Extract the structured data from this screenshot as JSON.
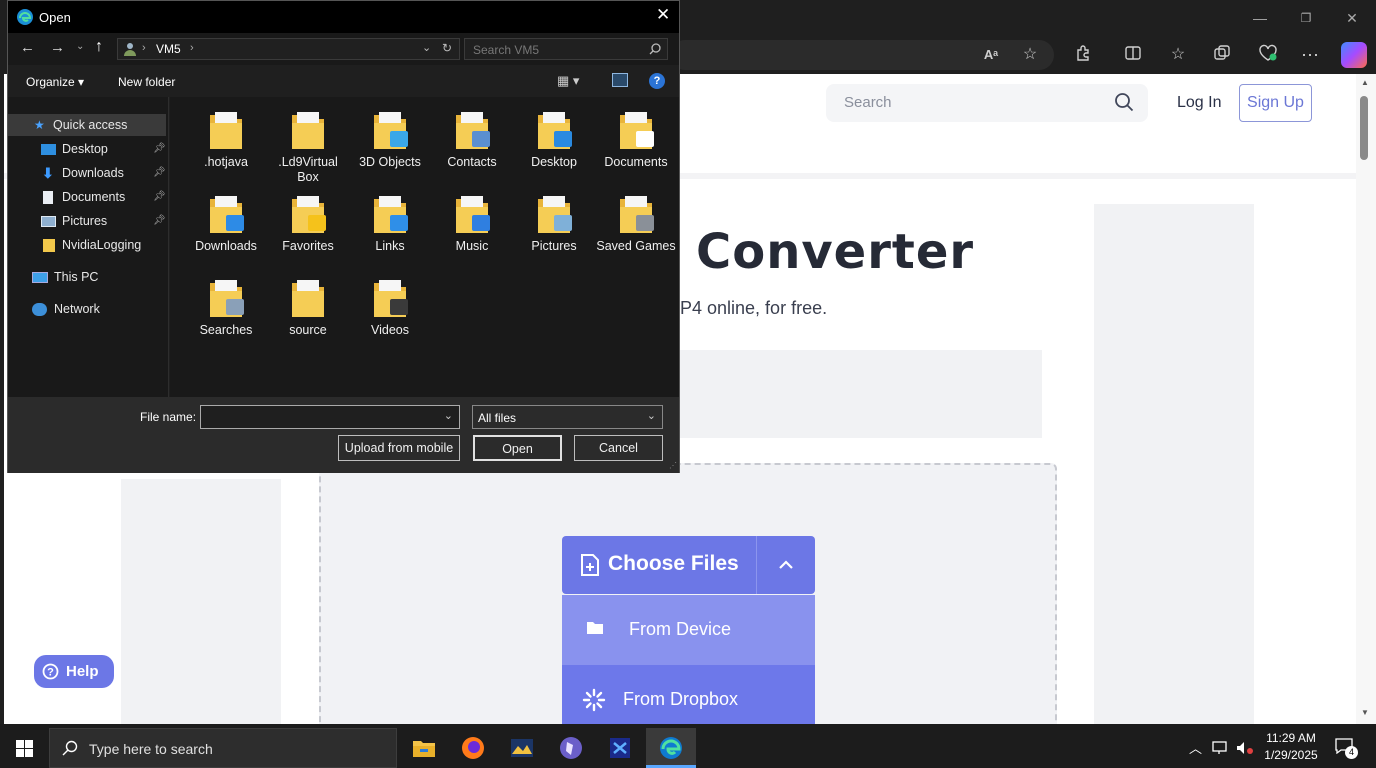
{
  "browser": {
    "window_controls": {
      "minimize": "—",
      "restore": "❐",
      "close": "✕"
    },
    "toolbar_icons": [
      "read-aloud-icon",
      "favorite-star-icon",
      "extensions-icon",
      "split-screen-icon",
      "favorites-icon",
      "collections-icon",
      "browser-essentials-icon",
      "more-icon",
      "copilot-icon"
    ]
  },
  "site": {
    "search_placeholder": "Search",
    "login": "Log In",
    "signup": "Sign Up",
    "hero_title": "Converter",
    "hero_subtitle": "P4 online, for free.",
    "choose_files": "Choose Files",
    "menu": [
      {
        "label": "From Device",
        "icon": "folder-icon"
      },
      {
        "label": "From Dropbox",
        "icon": "dropbox-spinner-icon"
      }
    ],
    "help": "Help",
    "accent_color": "#6c77e6"
  },
  "dialog": {
    "title": "Open",
    "path": [
      "VM5"
    ],
    "search_placeholder": "Search VM5",
    "organize": "Organize",
    "new_folder": "New folder",
    "nav": [
      {
        "label": "Quick access",
        "icon": "star-icon",
        "selected": true
      },
      {
        "label": "Desktop",
        "icon": "desktop-icon",
        "pinned": true
      },
      {
        "label": "Downloads",
        "icon": "download-icon",
        "pinned": true
      },
      {
        "label": "Documents",
        "icon": "document-icon",
        "pinned": true
      },
      {
        "label": "Pictures",
        "icon": "picture-icon",
        "pinned": true
      },
      {
        "label": "NvidiaLogging",
        "icon": "folder-icon"
      },
      {
        "label": "This PC",
        "icon": "computer-icon"
      },
      {
        "label": "Network",
        "icon": "network-icon"
      }
    ],
    "items": [
      {
        "label": ".hotjava",
        "overlay": "none"
      },
      {
        "label": ".Ld9Virtual Box",
        "overlay": "none"
      },
      {
        "label": "3D Objects",
        "overlay": "cube"
      },
      {
        "label": "Contacts",
        "overlay": "card"
      },
      {
        "label": "Desktop",
        "overlay": "screen"
      },
      {
        "label": "Documents",
        "overlay": "doc"
      },
      {
        "label": "Downloads",
        "overlay": "arrow"
      },
      {
        "label": "Favorites",
        "overlay": "star"
      },
      {
        "label": "Links",
        "overlay": "link"
      },
      {
        "label": "Music",
        "overlay": "note"
      },
      {
        "label": "Pictures",
        "overlay": "photo"
      },
      {
        "label": "Saved Games",
        "overlay": "chess"
      },
      {
        "label": "Searches",
        "overlay": "magnifier"
      },
      {
        "label": "source",
        "overlay": "none"
      },
      {
        "label": "Videos",
        "overlay": "film"
      }
    ],
    "filename_label": "File name:",
    "filename_value": "",
    "filetype": "All files",
    "upload_mobile": "Upload from mobile",
    "open": "Open",
    "cancel": "Cancel"
  },
  "taskbar": {
    "search_placeholder": "Type here to search",
    "time": "11:29 AM",
    "date": "1/29/2025",
    "notification_count": "4",
    "apps": [
      "file-explorer-icon",
      "firefox-icon",
      "app-icon",
      "obsidian-icon",
      "visual-studio-icon",
      "edge-icon"
    ]
  }
}
